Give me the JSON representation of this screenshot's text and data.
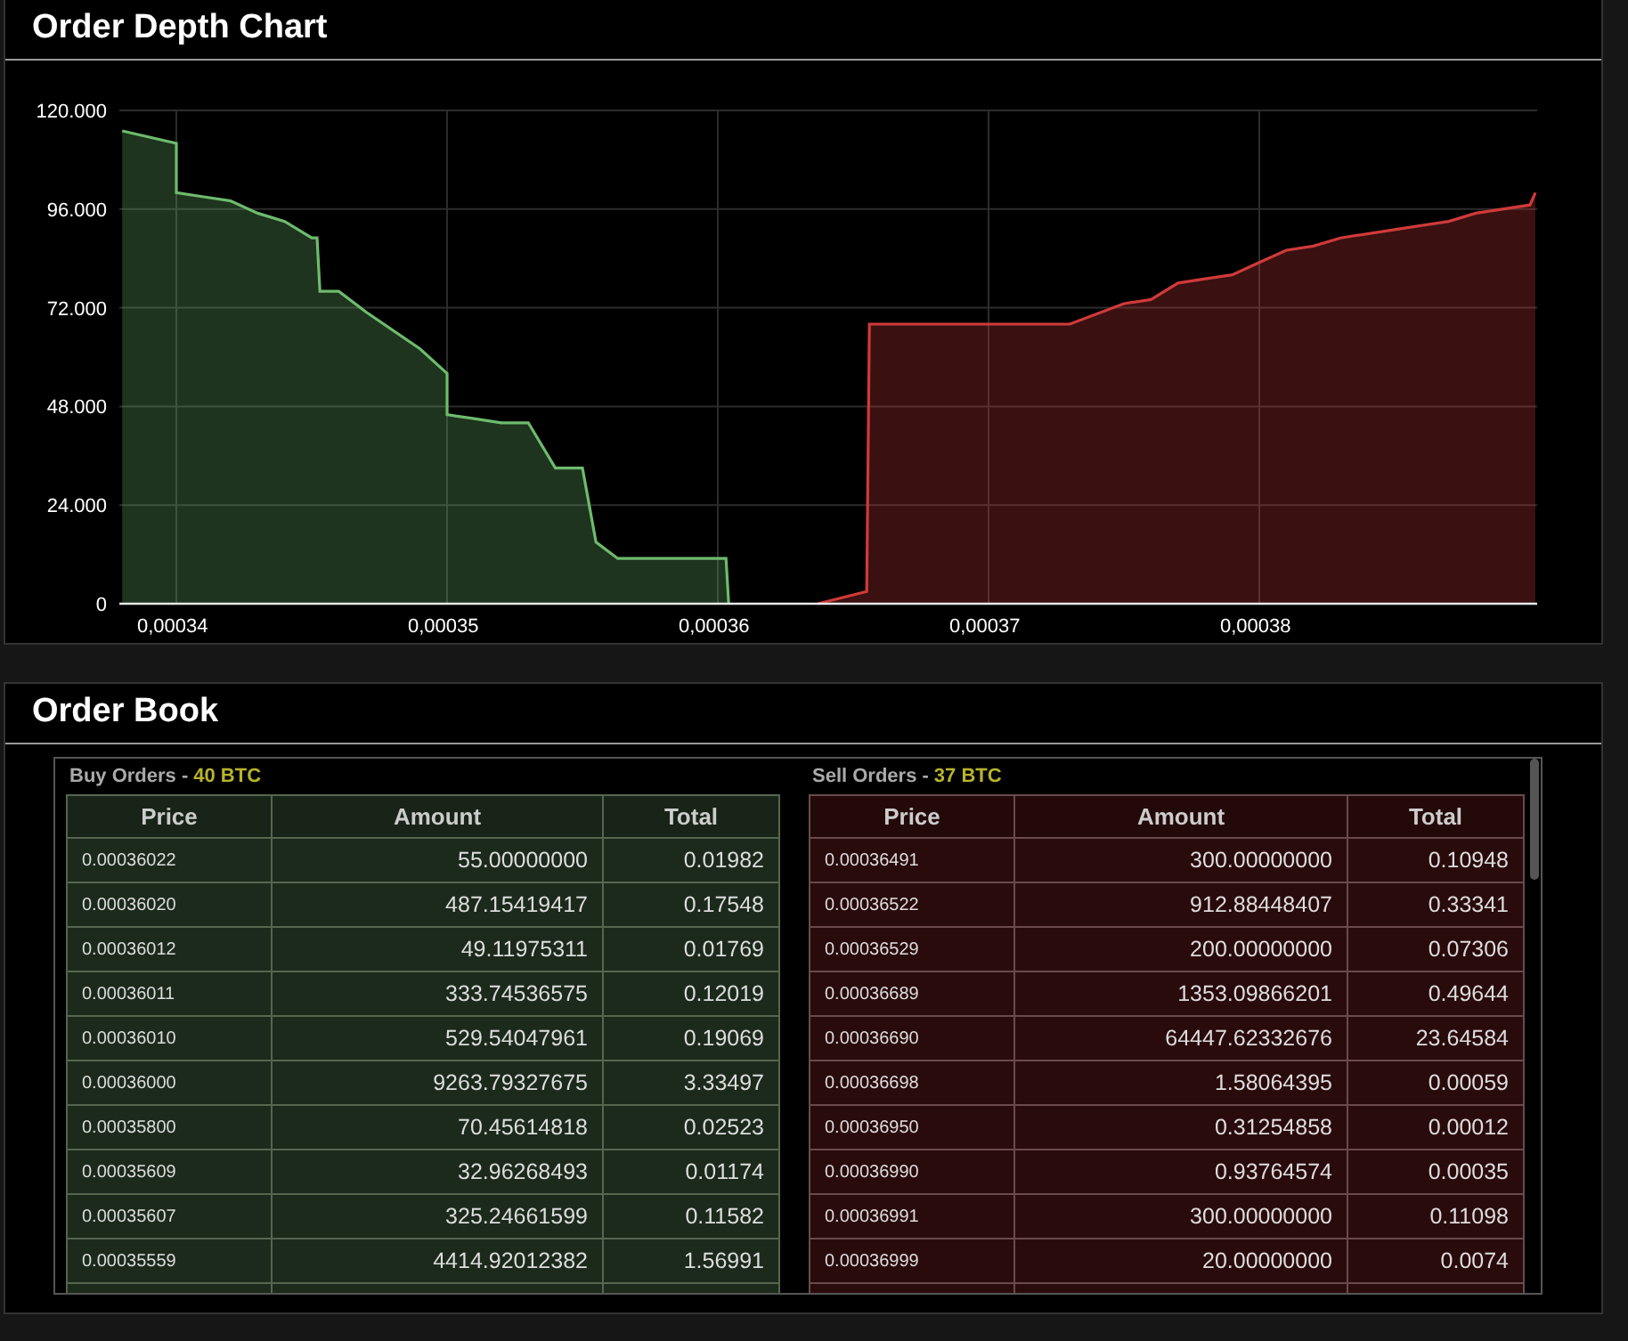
{
  "depth_chart": {
    "title": "Order Depth Chart",
    "chart_data": {
      "type": "area",
      "grid": true,
      "x": [
        0.000338,
        0.00034,
        0.00034,
        0.000341,
        0.000342,
        0.000343,
        0.000344,
        0.000345,
        0.0003452,
        0.0003453,
        0.000346,
        0.000347,
        0.000349,
        0.00035,
        0.00035,
        0.000351,
        0.000352,
        0.000353,
        0.000354,
        0.000355,
        0.0003555,
        0.0003563,
        0.000358,
        0.00036,
        0.0003603,
        0.0003604,
        0.0003637,
        0.0003655,
        0.0003656,
        0.000373,
        0.000375,
        0.000376,
        0.000377,
        0.000378,
        0.000379,
        0.00038,
        0.000381,
        0.000382,
        0.000383,
        0.000385,
        0.000387,
        0.000388,
        0.00039,
        0.0003902
      ],
      "series": [
        {
          "color": "#6dbb6d",
          "values": [
            115,
            112,
            100,
            99,
            98,
            95,
            93,
            89,
            89,
            76,
            76,
            71,
            62,
            56,
            46,
            45,
            44,
            44,
            33,
            33,
            15,
            11,
            11,
            11,
            11,
            0,
            null,
            null,
            null,
            null,
            null,
            null,
            null,
            null,
            null,
            null,
            null,
            null,
            null,
            null,
            null,
            null,
            null,
            null
          ]
        },
        {
          "color": "#d03a3a",
          "values": [
            null,
            null,
            null,
            null,
            null,
            null,
            null,
            null,
            null,
            null,
            null,
            null,
            null,
            null,
            null,
            null,
            null,
            null,
            null,
            null,
            null,
            null,
            null,
            null,
            null,
            null,
            0,
            3,
            68,
            68,
            73,
            74,
            78,
            79,
            80,
            83,
            86,
            87,
            89,
            91,
            93,
            95,
            97,
            100
          ]
        }
      ],
      "xlim": [
        0.000337895,
        0.000390263
      ],
      "ylim": [
        0,
        120
      ],
      "xticks": [
        {
          "value": 0.00034,
          "label": "0,00034"
        },
        {
          "value": 0.00035,
          "label": "0,00035"
        },
        {
          "value": 0.00036,
          "label": "0,00036"
        },
        {
          "value": 0.00037,
          "label": "0,00037"
        },
        {
          "value": 0.00038,
          "label": "0,00038"
        }
      ],
      "yticks": [
        {
          "value": 0,
          "label": "0"
        },
        {
          "value": 24,
          "label": "24.000"
        },
        {
          "value": 48,
          "label": "48.000"
        },
        {
          "value": 72,
          "label": "72.000"
        },
        {
          "value": 96,
          "label": "96.000"
        },
        {
          "value": 120,
          "label": "120.000"
        }
      ]
    }
  },
  "order_book": {
    "title": "Order Book",
    "tables": [
      {
        "kind": "buy",
        "label": "Buy Orders -",
        "total": "40 BTC",
        "columns": [
          "Price",
          "Amount",
          "Total"
        ],
        "rows": [
          [
            "0.00036022",
            "55.00000000",
            "0.01982"
          ],
          [
            "0.00036020",
            "487.15419417",
            "0.17548"
          ],
          [
            "0.00036012",
            "49.11975311",
            "0.01769"
          ],
          [
            "0.00036011",
            "333.74536575",
            "0.12019"
          ],
          [
            "0.00036010",
            "529.54047961",
            "0.19069"
          ],
          [
            "0.00036000",
            "9263.79327675",
            "3.33497"
          ],
          [
            "0.00035800",
            "70.45614818",
            "0.02523"
          ],
          [
            "0.00035609",
            "32.96268493",
            "0.01174"
          ],
          [
            "0.00035607",
            "325.24661599",
            "0.11582"
          ],
          [
            "0.00035559",
            "4414.92012382",
            "1.56991"
          ]
        ]
      },
      {
        "kind": "sell",
        "label": "Sell Orders -",
        "total": "37 BTC",
        "columns": [
          "Price",
          "Amount",
          "Total"
        ],
        "rows": [
          [
            "0.00036491",
            "300.00000000",
            "0.10948"
          ],
          [
            "0.00036522",
            "912.88448407",
            "0.33341"
          ],
          [
            "0.00036529",
            "200.00000000",
            "0.07306"
          ],
          [
            "0.00036689",
            "1353.09866201",
            "0.49644"
          ],
          [
            "0.00036690",
            "64447.62332676",
            "23.64584"
          ],
          [
            "0.00036698",
            "1.58064395",
            "0.00059"
          ],
          [
            "0.00036950",
            "0.31254858",
            "0.00012"
          ],
          [
            "0.00036990",
            "0.93764574",
            "0.00035"
          ],
          [
            "0.00036991",
            "300.00000000",
            "0.11098"
          ],
          [
            "0.00036999",
            "20.00000000",
            "0.0074"
          ]
        ]
      }
    ]
  }
}
